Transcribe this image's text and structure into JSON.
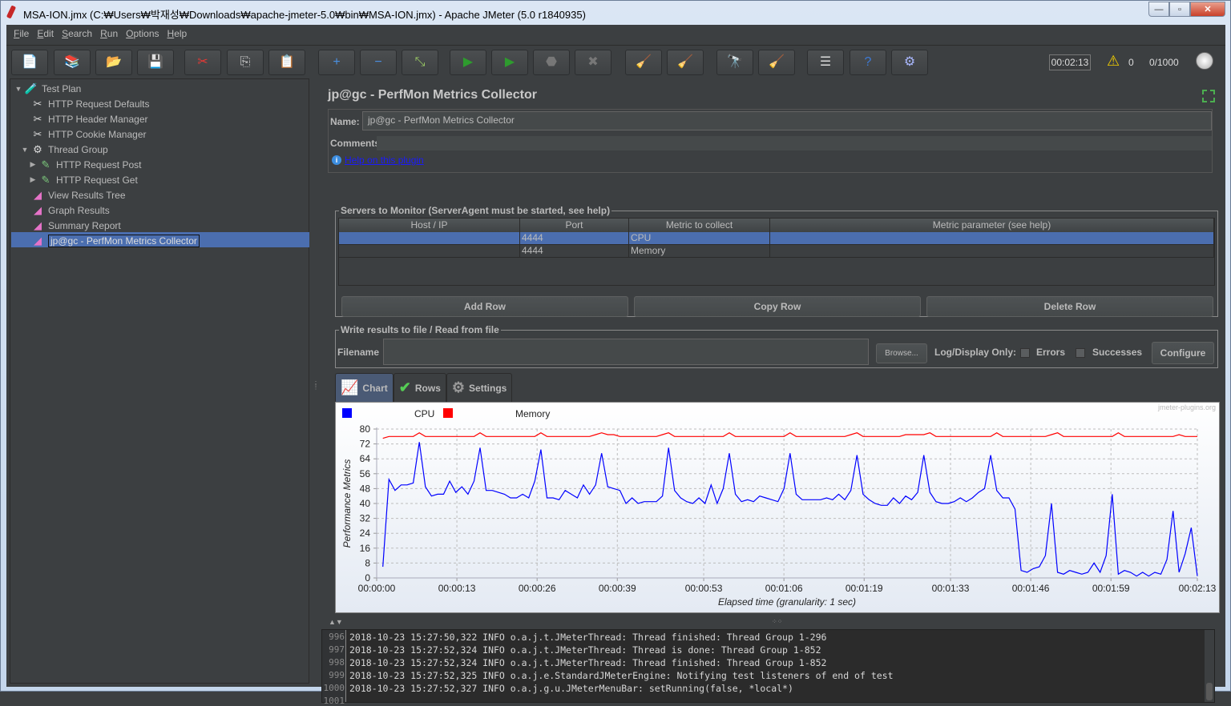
{
  "window": {
    "title": "MSA-ION.jmx (C:₩Users₩박재성₩Downloads₩apache-jmeter-5.0₩bin₩MSA-ION.jmx) - Apache JMeter (5.0 r1840935)",
    "minimize": "—",
    "maximize": "▫",
    "close": "✕"
  },
  "menu": [
    {
      "key": "F",
      "rest": "ile"
    },
    {
      "key": "E",
      "rest": "dit"
    },
    {
      "key": "S",
      "rest": "earch"
    },
    {
      "key": "R",
      "rest": "un"
    },
    {
      "key": "O",
      "rest": "ptions"
    },
    {
      "key": "H",
      "rest": "elp"
    }
  ],
  "toolbar": {
    "buttons": [
      {
        "name": "new-icon",
        "glyph": "📄"
      },
      {
        "name": "templates-icon",
        "glyph": "📚"
      },
      {
        "name": "open-icon",
        "glyph": "📂"
      },
      {
        "name": "save-icon",
        "glyph": "💾"
      },
      {
        "name": "cut-icon",
        "glyph": "✂"
      },
      {
        "name": "copy-icon",
        "glyph": "⎘"
      },
      {
        "name": "paste-icon",
        "glyph": "📋"
      },
      {
        "name": "expand-all-icon",
        "glyph": "+"
      },
      {
        "name": "collapse-all-icon",
        "glyph": "−"
      },
      {
        "name": "toggle-icon",
        "glyph": "⤡"
      },
      {
        "name": "start-icon",
        "glyph": "▶"
      },
      {
        "name": "start-no-pauses-icon",
        "glyph": "▶"
      },
      {
        "name": "stop-icon",
        "glyph": "⬣"
      },
      {
        "name": "shutdown-icon",
        "glyph": "✖"
      },
      {
        "name": "clear-icon",
        "glyph": "🧹"
      },
      {
        "name": "clear-all-icon",
        "glyph": "🧹"
      },
      {
        "name": "search-icon",
        "glyph": "🔭"
      },
      {
        "name": "reset-search-icon",
        "glyph": "🧹"
      },
      {
        "name": "function-helper-icon",
        "glyph": "☰"
      },
      {
        "name": "help-icon",
        "glyph": "?"
      },
      {
        "name": "remote-start-icon",
        "glyph": "⚙"
      }
    ],
    "elapsed": "00:02:13",
    "warnings": "0",
    "threads": "0/1000"
  },
  "tree": [
    {
      "label": "Test Plan",
      "level": 0,
      "arrow": "▼",
      "icon": "🧪",
      "iconName": "test-plan-icon"
    },
    {
      "label": "HTTP Request Defaults",
      "level": 1,
      "arrow": "",
      "icon": "✂",
      "iconName": "config-element-icon"
    },
    {
      "label": "HTTP Header Manager",
      "level": 1,
      "arrow": "",
      "icon": "✂",
      "iconName": "config-element-icon"
    },
    {
      "label": "HTTP Cookie Manager",
      "level": 1,
      "arrow": "",
      "icon": "✂",
      "iconName": "config-element-icon"
    },
    {
      "label": "Thread Group",
      "level": 1,
      "arrow": "▼",
      "icon": "⚙",
      "iconName": "thread-group-icon"
    },
    {
      "label": "HTTP Request Post",
      "level": 2,
      "arrow": "▶",
      "icon": "✎",
      "iconName": "sampler-icon"
    },
    {
      "label": "HTTP Request Get",
      "level": 2,
      "arrow": "▶",
      "icon": "✎",
      "iconName": "sampler-icon"
    },
    {
      "label": "View Results Tree",
      "level": 1,
      "arrow": "",
      "icon": "◢",
      "iconName": "listener-icon"
    },
    {
      "label": "Graph Results",
      "level": 1,
      "arrow": "",
      "icon": "◢",
      "iconName": "listener-icon"
    },
    {
      "label": "Summary Report",
      "level": 1,
      "arrow": "",
      "icon": "◢",
      "iconName": "listener-icon"
    },
    {
      "label": "jp@gc - PerfMon Metrics Collector",
      "level": 1,
      "arrow": "",
      "icon": "◢",
      "iconName": "listener-icon",
      "selected": true
    }
  ],
  "panel": {
    "title": "jp@gc - PerfMon Metrics Collector",
    "name_label": "Name:",
    "name_value": "jp@gc - PerfMon Metrics Collector",
    "comments_label": "Comments:",
    "comments_value": "",
    "help_link": "Help on this plugin",
    "servers_legend": "Servers to Monitor (ServerAgent must be started, see help)",
    "columns": [
      "Host / IP",
      "Port",
      "Metric to collect",
      "Metric parameter (see help)"
    ],
    "rows": [
      {
        "host": "",
        "port": "4444",
        "metric": "CPU",
        "param": "",
        "selected": true
      },
      {
        "host": "",
        "port": "4444",
        "metric": "Memory",
        "param": "",
        "selected": false
      }
    ],
    "add_row": "Add Row",
    "copy_row": "Copy Row",
    "delete_row": "Delete Row",
    "file_legend": "Write results to file / Read from file",
    "filename_label": "Filename",
    "filename_value": "",
    "browse": "Browse...",
    "log_display_only": "Log/Display Only:",
    "errors": "Errors",
    "errors_checked": false,
    "successes": "Successes",
    "successes_checked": false,
    "configure": "Configure",
    "tabs": [
      {
        "label": "Chart",
        "icon": "📈",
        "active": true
      },
      {
        "label": "Rows",
        "icon": "✔",
        "active": false
      },
      {
        "label": "Settings",
        "icon": "⚙",
        "active": false
      }
    ]
  },
  "chart_data": {
    "type": "line",
    "title": "",
    "watermark": "jmeter-plugins.org",
    "xlabel": "Elapsed time (granularity: 1 sec)",
    "ylabel": "Performance Metrics",
    "ylim": [
      0,
      80
    ],
    "xlim_seconds": [
      0,
      133
    ],
    "yticks": [
      0,
      8,
      16,
      24,
      32,
      40,
      48,
      56,
      64,
      72,
      80
    ],
    "xticks": [
      "00:00:00",
      "00:00:13",
      "00:00:26",
      "00:00:39",
      "00:00:53",
      "00:01:06",
      "00:01:19",
      "00:01:33",
      "00:01:46",
      "00:01:59",
      "00:02:13"
    ],
    "xtick_seconds": [
      0,
      13,
      26,
      39,
      53,
      66,
      79,
      93,
      106,
      119,
      133
    ],
    "grid": true,
    "legend_position": "top-left",
    "series": [
      {
        "name": "CPU",
        "color": "#0000ff",
        "start_second": 1,
        "values": [
          6,
          53,
          47,
          50,
          50,
          51,
          73,
          49,
          44,
          45,
          45,
          52,
          46,
          49,
          45,
          52,
          70,
          47,
          47,
          46,
          45,
          43,
          43,
          45,
          43,
          52,
          69,
          43,
          43,
          42,
          47,
          45,
          43,
          50,
          45,
          50,
          67,
          49,
          48,
          47,
          40,
          43,
          40,
          41,
          41,
          41,
          44,
          70,
          47,
          43,
          41,
          40,
          43,
          40,
          50,
          40,
          48,
          67,
          45,
          41,
          42,
          41,
          44,
          43,
          42,
          41,
          48,
          67,
          45,
          42,
          42,
          42,
          42,
          43,
          42,
          45,
          42,
          47,
          66,
          45,
          42,
          40,
          39,
          39,
          43,
          40,
          44,
          42,
          46,
          66,
          46,
          41,
          40,
          40,
          41,
          43,
          41,
          43,
          46,
          48,
          66,
          47,
          43,
          43,
          37,
          4,
          3,
          5,
          6,
          12,
          40,
          3,
          2,
          4,
          3,
          2,
          3,
          8,
          3,
          12,
          45,
          2,
          4,
          3,
          1,
          3,
          1,
          3,
          2,
          10,
          36,
          3,
          13,
          27,
          1
        ]
      },
      {
        "name": "Memory",
        "color": "#ff0000",
        "start_second": 1,
        "values": [
          75,
          76,
          76,
          76,
          76,
          76,
          78,
          76,
          76,
          76,
          76,
          76,
          76,
          76,
          76,
          76,
          78,
          76,
          76,
          76,
          76,
          76,
          76,
          76,
          76,
          76,
          78,
          76,
          76,
          76,
          76,
          76,
          76,
          76,
          76,
          77,
          78,
          77,
          77,
          76,
          76,
          76,
          76,
          76,
          76,
          76,
          77,
          78,
          76,
          76,
          76,
          76,
          76,
          76,
          76,
          76,
          76,
          78,
          76,
          76,
          76,
          76,
          76,
          76,
          76,
          76,
          76,
          78,
          76,
          76,
          76,
          76,
          76,
          76,
          76,
          76,
          76,
          77,
          78,
          76,
          76,
          76,
          76,
          76,
          76,
          76,
          77,
          77,
          77,
          77,
          78,
          76,
          76,
          76,
          76,
          76,
          76,
          76,
          76,
          76,
          76,
          78,
          76,
          76,
          76,
          76,
          76,
          76,
          76,
          76,
          77,
          78,
          76,
          76,
          76,
          76,
          76,
          76,
          76,
          76,
          76,
          78,
          76,
          76,
          76,
          76,
          76,
          76,
          76,
          76,
          76,
          77,
          76,
          76,
          76
        ]
      }
    ]
  },
  "log": {
    "lines": [
      {
        "n": "996",
        "text": "2018-10-23 15:27:50,322 INFO o.a.j.t.JMeterThread: Thread finished: Thread Group 1-296"
      },
      {
        "n": "997",
        "text": "2018-10-23 15:27:52,324 INFO o.a.j.t.JMeterThread: Thread is done: Thread Group 1-852"
      },
      {
        "n": "998",
        "text": "2018-10-23 15:27:52,324 INFO o.a.j.t.JMeterThread: Thread finished: Thread Group 1-852"
      },
      {
        "n": "999",
        "text": "2018-10-23 15:27:52,325 INFO o.a.j.e.StandardJMeterEngine: Notifying test listeners of end of test"
      },
      {
        "n": "1000",
        "text": "2018-10-23 15:27:52,327 INFO o.a.j.g.u.JMeterMenuBar: setRunning(false, *local*)"
      },
      {
        "n": "1001",
        "text": ""
      }
    ]
  }
}
